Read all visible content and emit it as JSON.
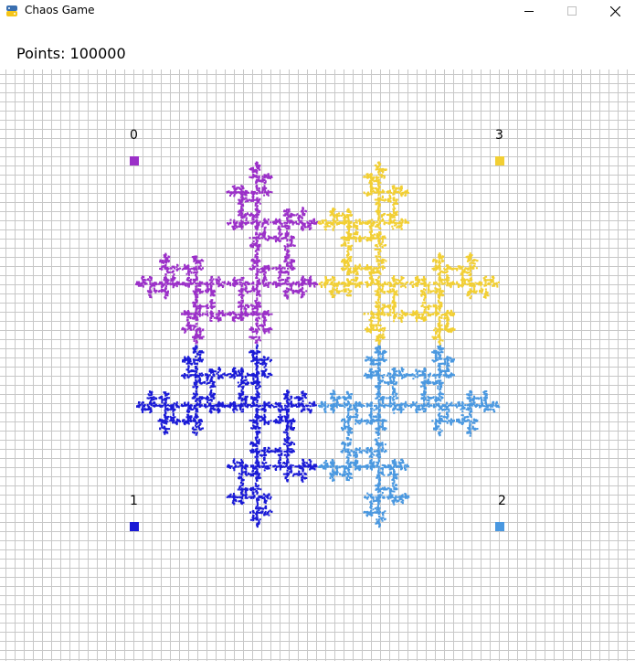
{
  "window": {
    "title": "Chaos Game"
  },
  "app_icon": "python-icon",
  "controls": {
    "minimize_icon": "minimize-icon",
    "maximize_icon": "maximize-icon",
    "close_icon": "close-icon"
  },
  "header": {
    "points_text": "Points: 100000"
  },
  "vertices": [
    {
      "label": "0",
      "color": "#9b30c8"
    },
    {
      "label": "1",
      "color": "#1a1ad6"
    },
    {
      "label": "2",
      "color": "#4a98e0"
    },
    {
      "label": "3",
      "color": "#f2cf33"
    }
  ],
  "colors": {
    "grid": "#c8c8c8",
    "background": "#ffffff"
  }
}
